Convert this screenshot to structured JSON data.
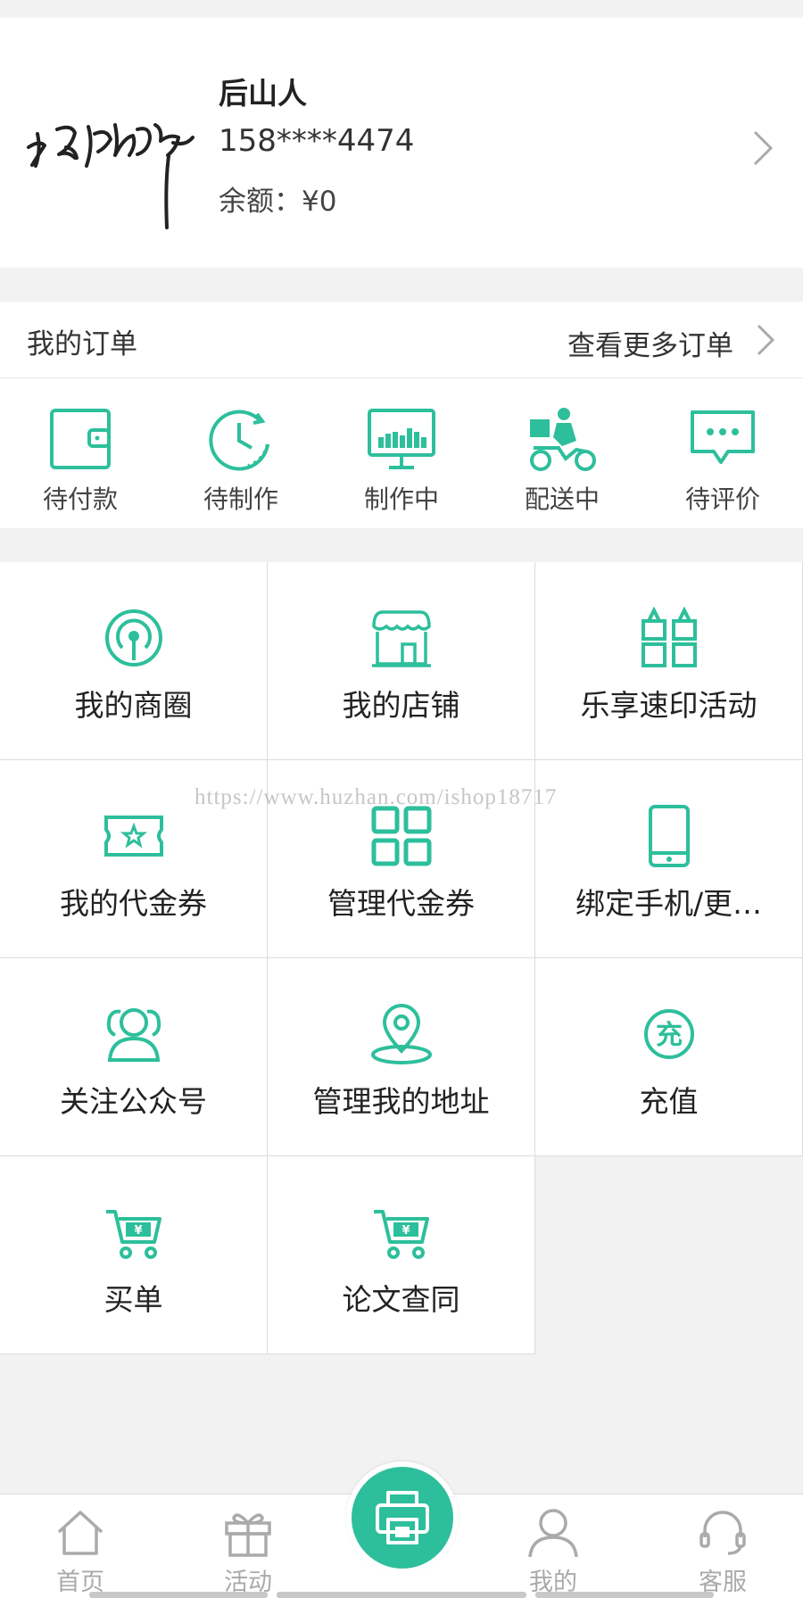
{
  "profile": {
    "name": "后山人",
    "phone": "158****4474",
    "balance": "余额：¥0"
  },
  "orders": {
    "title": "我的订单",
    "more": "查看更多订单",
    "statuses": [
      {
        "label": "待付款",
        "icon": "wallet-icon"
      },
      {
        "label": "待制作",
        "icon": "clock-icon"
      },
      {
        "label": "制作中",
        "icon": "monitor-icon"
      },
      {
        "label": "配送中",
        "icon": "delivery-icon"
      },
      {
        "label": "待评价",
        "icon": "chat-icon"
      }
    ]
  },
  "menu": [
    {
      "label": "我的商圈",
      "icon": "signal-icon"
    },
    {
      "label": "我的店铺",
      "icon": "store-icon"
    },
    {
      "label": "乐享速印活动",
      "icon": "gift-box-icon"
    },
    {
      "label": "我的代金券",
      "icon": "coupon-icon"
    },
    {
      "label": "管理代金券",
      "icon": "grid-icon"
    },
    {
      "label": "绑定手机/更…",
      "icon": "phone-icon"
    },
    {
      "label": "关注公众号",
      "icon": "users-icon"
    },
    {
      "label": "管理我的地址",
      "icon": "location-icon"
    },
    {
      "label": "充值",
      "icon": "recharge-icon"
    },
    {
      "label": "买单",
      "icon": "cart-icon"
    },
    {
      "label": "论文查同",
      "icon": "cart-icon"
    }
  ],
  "watermark": "https://www.huzhan.com/ishop18717",
  "tabbar": {
    "home": "首页",
    "activity": "活动",
    "mine": "我的",
    "service": "客服",
    "center_icon": "printer-icon"
  },
  "colors": {
    "accent": "#2dbf9b",
    "background": "#f2f2f2"
  }
}
